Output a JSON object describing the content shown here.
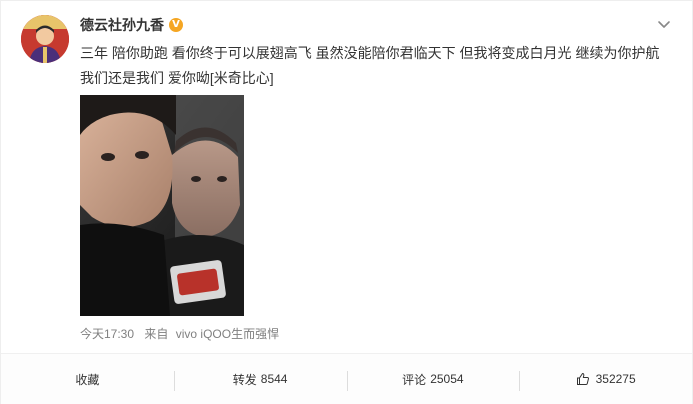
{
  "user": {
    "name": "德云社孙九香",
    "verified_badge": "V"
  },
  "post": {
    "text": "三年 陪你助跑 看你终于可以展翅高飞 虽然没能陪你君临天下 但我将变成白月光 继续为你护航 我们还是我们 爱你呦[米奇比心]",
    "time": "今天17:30",
    "source_prefix": "来自",
    "source_name": "vivo iQOO生而强悍"
  },
  "actions": {
    "favorite_label": "收藏",
    "repost_label": "转发",
    "repost_count": "8544",
    "comment_label": "评论",
    "comment_count": "25054",
    "like_count": "352275"
  },
  "icons": [
    "chevron-down-icon",
    "verified-icon",
    "thumbs-up-icon"
  ],
  "colors": {
    "badge": "#f5a623",
    "muted_text": "#808080",
    "text": "#333333"
  }
}
